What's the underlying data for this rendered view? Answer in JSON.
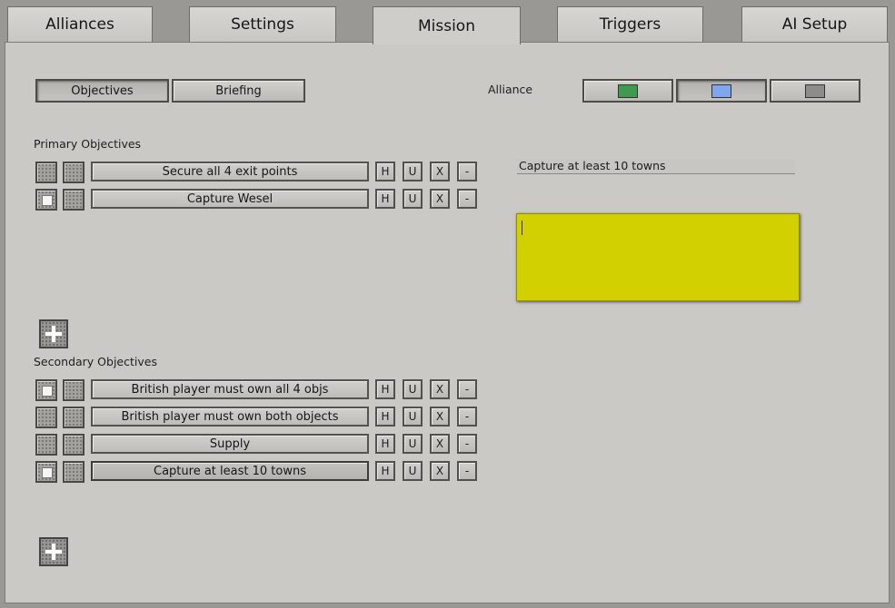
{
  "tabs": [
    {
      "label": "Alliances"
    },
    {
      "label": "Settings"
    },
    {
      "label": "Mission"
    },
    {
      "label": "Triggers"
    },
    {
      "label": "AI Setup"
    }
  ],
  "subtabs": {
    "objectives": "Objectives",
    "briefing": "Briefing"
  },
  "alliance": {
    "label": "Alliance",
    "colors": {
      "green": "#3e9a4e",
      "blue": "#7fa6ee",
      "gray": "#8d8c8a"
    },
    "selected": "blue"
  },
  "primary": {
    "heading": "Primary Objectives",
    "items": [
      {
        "name": "Secure all 4 exit points",
        "checked": false
      },
      {
        "name": "Capture Wesel",
        "checked": true
      }
    ]
  },
  "secondary": {
    "heading": "Secondary Objectives",
    "items": [
      {
        "name": "British player must own all 4 objs",
        "checked": true
      },
      {
        "name": "British player must own both objects",
        "checked": false
      },
      {
        "name": "Supply",
        "checked": false
      },
      {
        "name": "Capture at least 10 towns",
        "checked": true
      }
    ]
  },
  "action_buttons": {
    "h": "H",
    "u": "U",
    "x": "X",
    "minus": "-"
  },
  "detail": {
    "title_value": "Capture at least 10 towns",
    "description_value": "",
    "note_color": "#d2d000"
  },
  "icons": {
    "add": "plus-icon",
    "checkbox": "checkbox-icon"
  }
}
